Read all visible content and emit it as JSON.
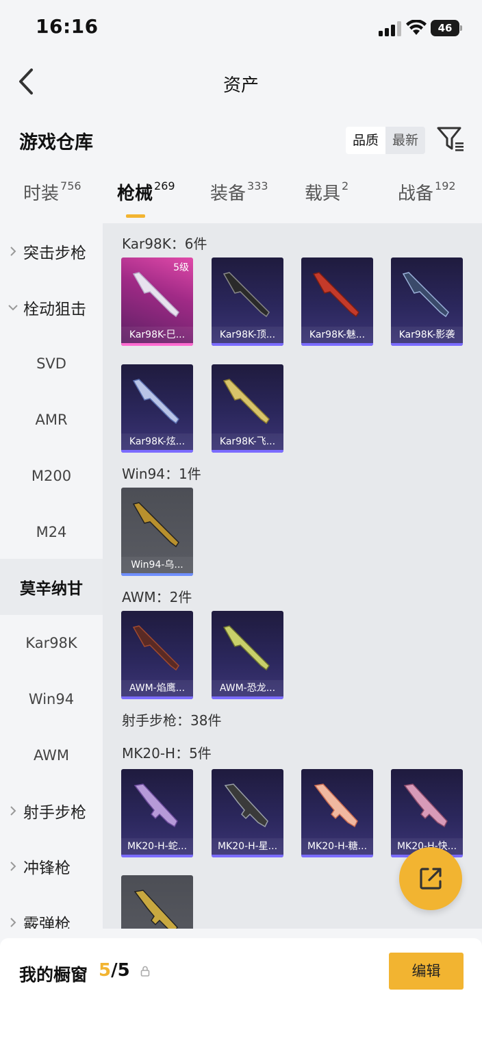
{
  "status": {
    "time": "16:16",
    "battery": "46"
  },
  "nav": {
    "title": "资产"
  },
  "warehouse": {
    "title": "游戏仓库",
    "sort_quality": "品质",
    "sort_latest": "最新"
  },
  "tabs": [
    {
      "label": "时装",
      "count": "756"
    },
    {
      "label": "枪械",
      "count": "269"
    },
    {
      "label": "装备",
      "count": "333"
    },
    {
      "label": "载具",
      "count": "2"
    },
    {
      "label": "战备",
      "count": "192"
    }
  ],
  "sidebar": [
    {
      "label": "突击步枪"
    },
    {
      "label": "栓动狙击"
    },
    {
      "label": "SVD"
    },
    {
      "label": "AMR"
    },
    {
      "label": "M200"
    },
    {
      "label": "M24"
    },
    {
      "label": "莫辛纳甘"
    },
    {
      "label": "Kar98K"
    },
    {
      "label": "Win94"
    },
    {
      "label": "AWM"
    },
    {
      "label": "射手步枪"
    },
    {
      "label": "冲锋枪"
    },
    {
      "label": "霰弹枪"
    }
  ],
  "sections": {
    "kar": {
      "title": "Kar98K：6件",
      "level": "5级",
      "items": [
        "Kar98K-巳...",
        "Kar98K-顶...",
        "Kar98K-魅...",
        "Kar98K-影袭",
        "Kar98K-炫...",
        "Kar98K-飞..."
      ]
    },
    "win": {
      "title": "Win94：1件",
      "items": [
        "Win94-乌..."
      ]
    },
    "awm": {
      "title": "AWM：2件",
      "items": [
        "AWM-焰鹰...",
        "AWM-恐龙..."
      ]
    },
    "marksman": {
      "title": "射手步枪：38件"
    },
    "mk20": {
      "title": "MK20-H：5件",
      "items": [
        "MK20-H-蛇...",
        "MK20-H-星...",
        "MK20-H-糖...",
        "MK20-H-快..."
      ]
    }
  },
  "showcase": {
    "label": "我的橱窗",
    "current": "5",
    "total": "/5",
    "edit": "编辑"
  },
  "colors": {
    "accent": "#f2b431"
  }
}
